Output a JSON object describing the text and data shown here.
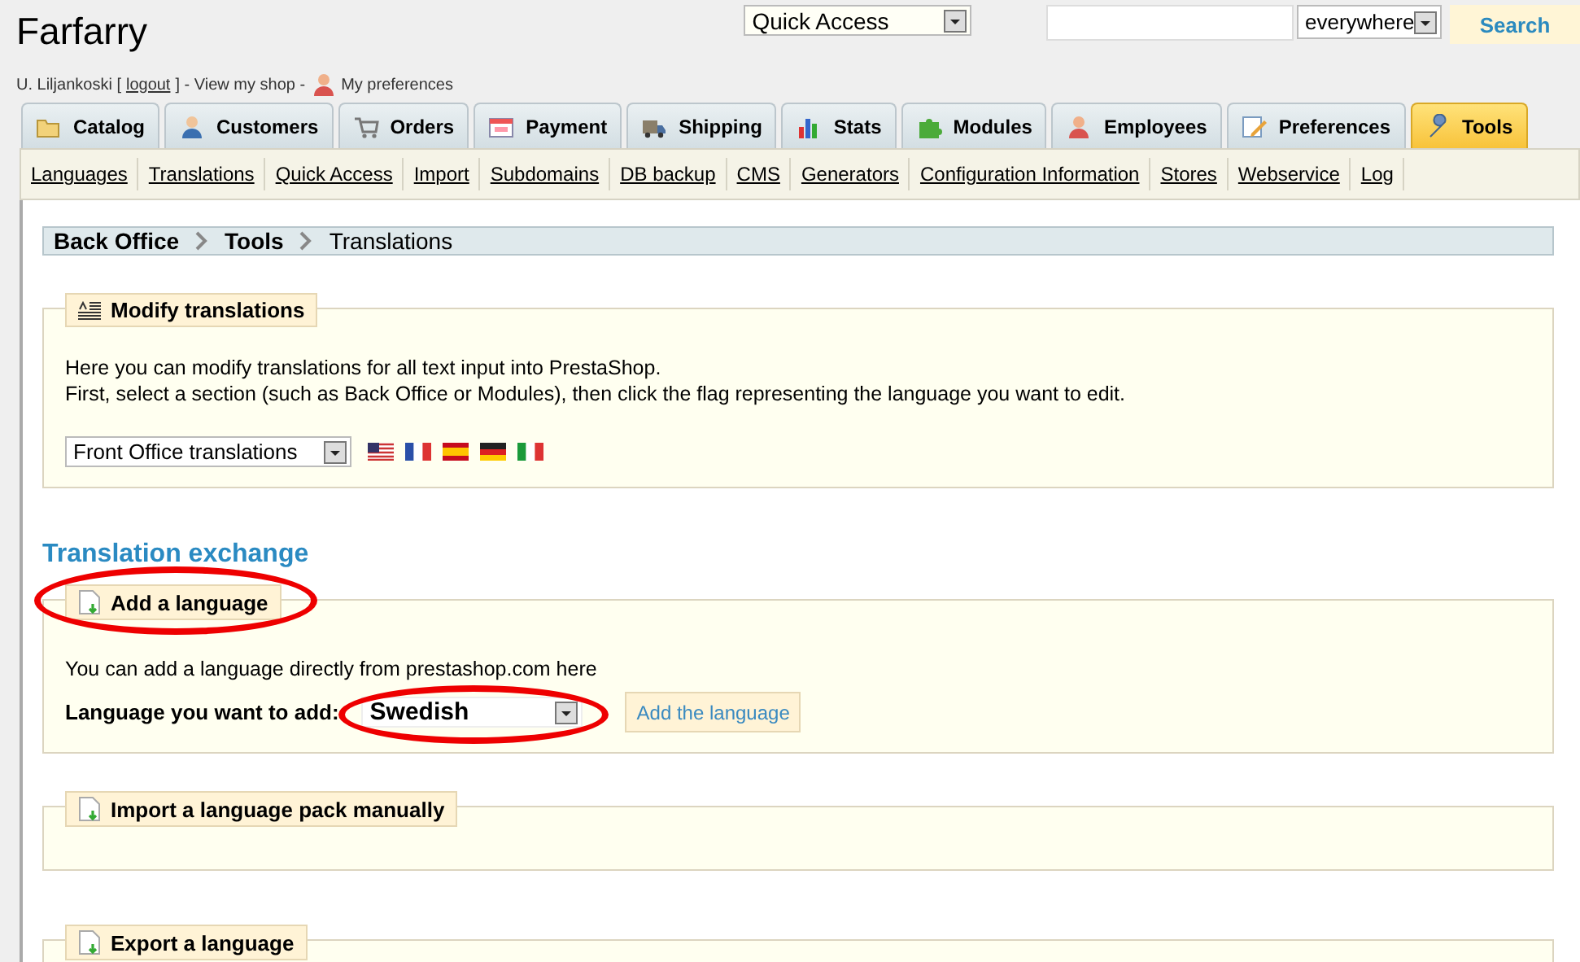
{
  "header": {
    "title": "Farfarry",
    "quick_access": "Quick Access",
    "search": {
      "scope": "everywhere",
      "button": "Search"
    },
    "user_line": {
      "name": "U. Liljankoski [",
      "logout": "logout",
      "after_logout": "] - View my shop -",
      "preferences": "My preferences"
    }
  },
  "tabs": [
    {
      "label": "Catalog",
      "selected": false
    },
    {
      "label": "Customers",
      "selected": false
    },
    {
      "label": "Orders",
      "selected": false
    },
    {
      "label": "Payment",
      "selected": false
    },
    {
      "label": "Shipping",
      "selected": false
    },
    {
      "label": "Stats",
      "selected": false
    },
    {
      "label": "Modules",
      "selected": false
    },
    {
      "label": "Employees",
      "selected": false
    },
    {
      "label": "Preferences",
      "selected": false
    },
    {
      "label": "Tools",
      "selected": true
    }
  ],
  "subtabs": [
    "Languages",
    "Translations",
    "Quick Access",
    "Import",
    "Subdomains",
    "DB backup",
    "CMS",
    "Generators",
    "Configuration Information",
    "Stores",
    "Webservice",
    "Log"
  ],
  "breadcrumb": [
    "Back Office",
    "Tools",
    "Translations"
  ],
  "modify": {
    "legend": "Modify translations",
    "lines": [
      "Here you can modify translations for all text input into PrestaShop.",
      "First, select a section (such as Back Office or Modules), then click the flag representing the language you want to edit."
    ],
    "select": "Front Office translations",
    "flags": [
      {
        "kind": "us"
      },
      {
        "kind": "fr"
      },
      {
        "kind": "es"
      },
      {
        "kind": "de"
      },
      {
        "kind": "it"
      }
    ]
  },
  "exchange_title": "Translation exchange",
  "add": {
    "legend": "Add a language",
    "circled": true,
    "text": "You can add a language directly from prestashop.com here",
    "label": "Language you want to add:",
    "select": "Swedish",
    "select_circled": true,
    "button": "Add the language"
  },
  "import": {
    "legend": "Import a language pack manually"
  },
  "export": {
    "legend": "Export a language"
  }
}
